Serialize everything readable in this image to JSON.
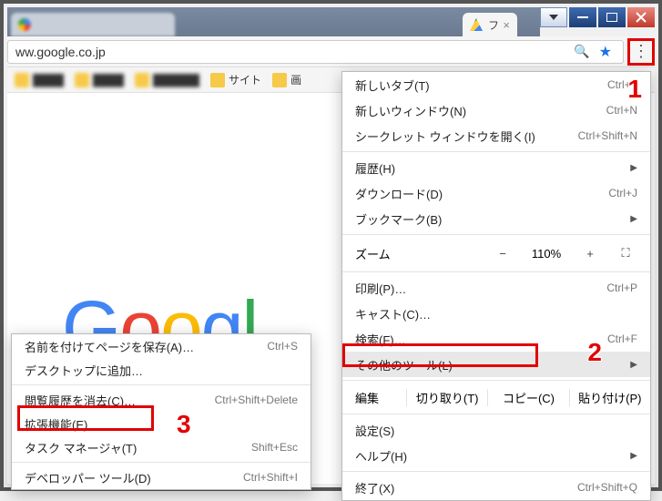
{
  "url": "ww.google.co.jp",
  "tabs": [
    {
      "label": ""
    },
    {
      "label": "フ"
    }
  ],
  "bookmarks": {
    "site_label": "サイト",
    "img_label": "画"
  },
  "logo_letters": [
    "G",
    "o",
    "o",
    "g",
    "l"
  ],
  "menu": {
    "new_tab": "新しいタブ(T)",
    "new_tab_sc": "Ctrl+T",
    "new_window": "新しいウィンドウ(N)",
    "new_window_sc": "Ctrl+N",
    "incognito": "シークレット ウィンドウを開く(I)",
    "incognito_sc": "Ctrl+Shift+N",
    "history": "履歴(H)",
    "downloads": "ダウンロード(D)",
    "downloads_sc": "Ctrl+J",
    "bookmarks": "ブックマーク(B)",
    "zoom_label": "ズーム",
    "zoom_minus": "−",
    "zoom_pct": "110%",
    "zoom_plus": "+",
    "print": "印刷(P)…",
    "print_sc": "Ctrl+P",
    "cast": "キャスト(C)…",
    "find": "検索(F)…",
    "find_sc": "Ctrl+F",
    "more_tools": "その他のツール(L)",
    "edit_label": "編集",
    "cut": "切り取り(T)",
    "copy": "コピー(C)",
    "paste": "貼り付け(P)",
    "settings": "設定(S)",
    "help": "ヘルプ(H)",
    "exit": "終了(X)",
    "exit_sc": "Ctrl+Shift+Q"
  },
  "submenu": {
    "save_as": "名前を付けてページを保存(A)…",
    "save_as_sc": "Ctrl+S",
    "add_desktop": "デスクトップに追加…",
    "clear_history": "閲覧履歴を消去(C)…",
    "clear_history_sc": "Ctrl+Shift+Delete",
    "extensions": "拡張機能(E)",
    "task_manager": "タスク マネージャ(T)",
    "task_manager_sc": "Shift+Esc",
    "dev_tools": "デベロッパー ツール(D)",
    "dev_tools_sc": "Ctrl+Shift+I"
  },
  "annotations": {
    "n1": "1",
    "n2": "2",
    "n3": "3"
  }
}
